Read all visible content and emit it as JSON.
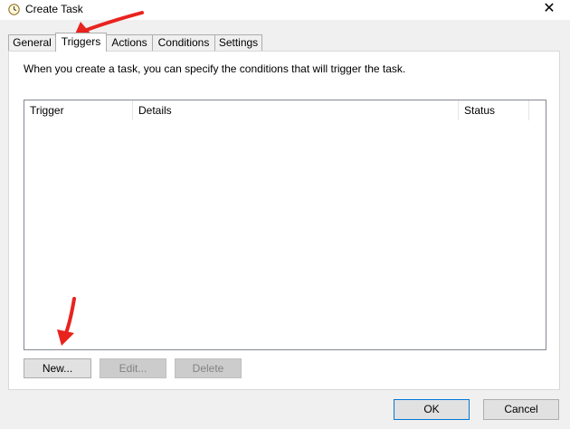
{
  "window": {
    "title": "Create Task",
    "app_icon": "clock-icon",
    "close_glyph": "✕"
  },
  "tabs": [
    {
      "label": "General",
      "active": false
    },
    {
      "label": "Triggers",
      "active": true
    },
    {
      "label": "Actions",
      "active": false
    },
    {
      "label": "Conditions",
      "active": false
    },
    {
      "label": "Settings",
      "active": false
    }
  ],
  "triggers_panel": {
    "description": "When you create a task, you can specify the conditions that will trigger the task.",
    "columns": [
      "Trigger",
      "Details",
      "Status"
    ],
    "rows": [],
    "buttons": {
      "new": "New...",
      "edit": "Edit...",
      "delete": "Delete"
    }
  },
  "footer": {
    "ok": "OK",
    "cancel": "Cancel"
  },
  "colors": {
    "annotation_arrow": "#e8231e",
    "primary_button_border": "#0078d7"
  }
}
